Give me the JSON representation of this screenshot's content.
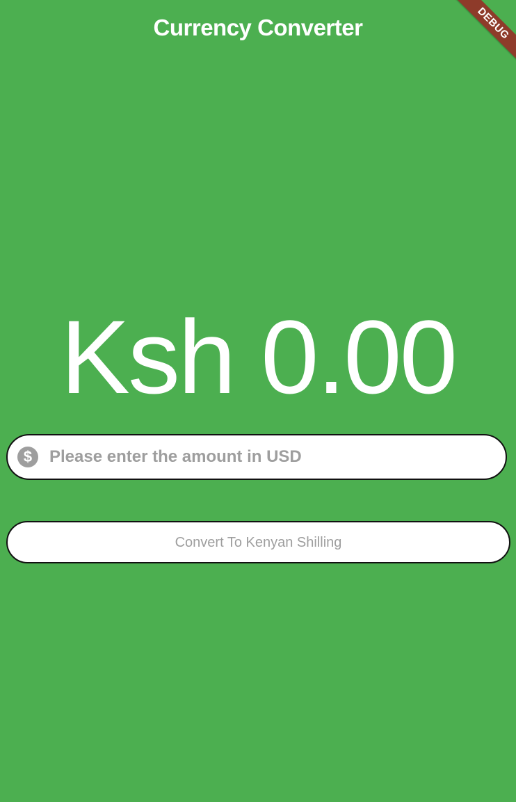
{
  "app": {
    "title": "Currency Converter",
    "debug_banner": "DEBUG"
  },
  "result": {
    "amount_text": "Ksh 0.00"
  },
  "input": {
    "value": "",
    "placeholder": "Please enter the amount in USD",
    "icon": "dollar-circle-icon"
  },
  "convert_button": {
    "label": "Convert To Kenyan Shilling"
  },
  "colors": {
    "background": "#4caf50",
    "text_on_background": "#ffffff",
    "field_background": "#ffffff",
    "field_border": "#111111",
    "hint_text": "#9e9e9e",
    "debug_banner": "#8e3b2a"
  }
}
